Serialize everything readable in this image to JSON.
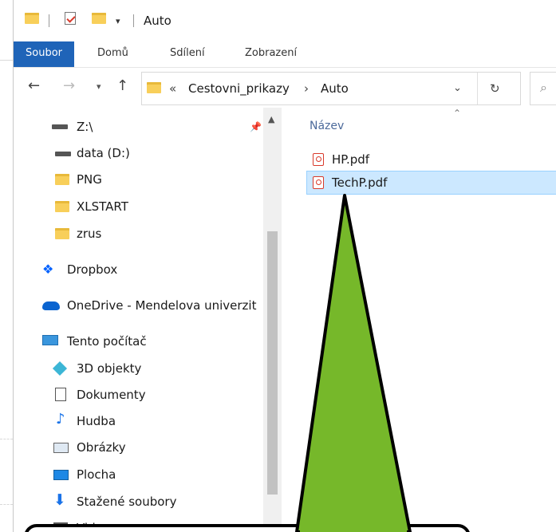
{
  "window": {
    "title": "Auto"
  },
  "ribbon": {
    "tabs": [
      "Soubor",
      "Domů",
      "Sdílení",
      "Zobrazení"
    ]
  },
  "address": {
    "overflow": "«",
    "path": [
      "Cestovni_prikazy",
      "Auto"
    ],
    "separator": "›"
  },
  "nav": {
    "items": [
      {
        "label": "Z:\\",
        "icon": "network-drive-icon"
      },
      {
        "label": "data (D:)",
        "icon": "drive-icon"
      },
      {
        "label": "PNG",
        "icon": "folder-icon"
      },
      {
        "label": "XLSTART",
        "icon": "folder-icon"
      },
      {
        "label": "zrus",
        "icon": "folder-icon"
      },
      {
        "label": "Dropbox",
        "icon": "dropbox-icon"
      },
      {
        "label": "OneDrive - Mendelova univerzit",
        "icon": "onedrive-icon"
      },
      {
        "label": "Tento počítač",
        "icon": "computer-icon"
      },
      {
        "label": "3D objekty",
        "icon": "3d-objects-icon"
      },
      {
        "label": "Dokumenty",
        "icon": "documents-icon"
      },
      {
        "label": "Hudba",
        "icon": "music-icon"
      },
      {
        "label": "Obrázky",
        "icon": "pictures-icon"
      },
      {
        "label": "Plocha",
        "icon": "desktop-icon"
      },
      {
        "label": "Stažené soubory",
        "icon": "downloads-icon"
      },
      {
        "label": "Videa",
        "icon": "videos-icon"
      }
    ]
  },
  "files": {
    "column_header": "Název",
    "items": [
      {
        "name": "HP.pdf",
        "selected": false
      },
      {
        "name": "TechP.pdf",
        "selected": true
      }
    ]
  },
  "colors": {
    "accent": "#1f64b8",
    "selection": "#cce8ff",
    "callout_fill": "#76b82a"
  }
}
